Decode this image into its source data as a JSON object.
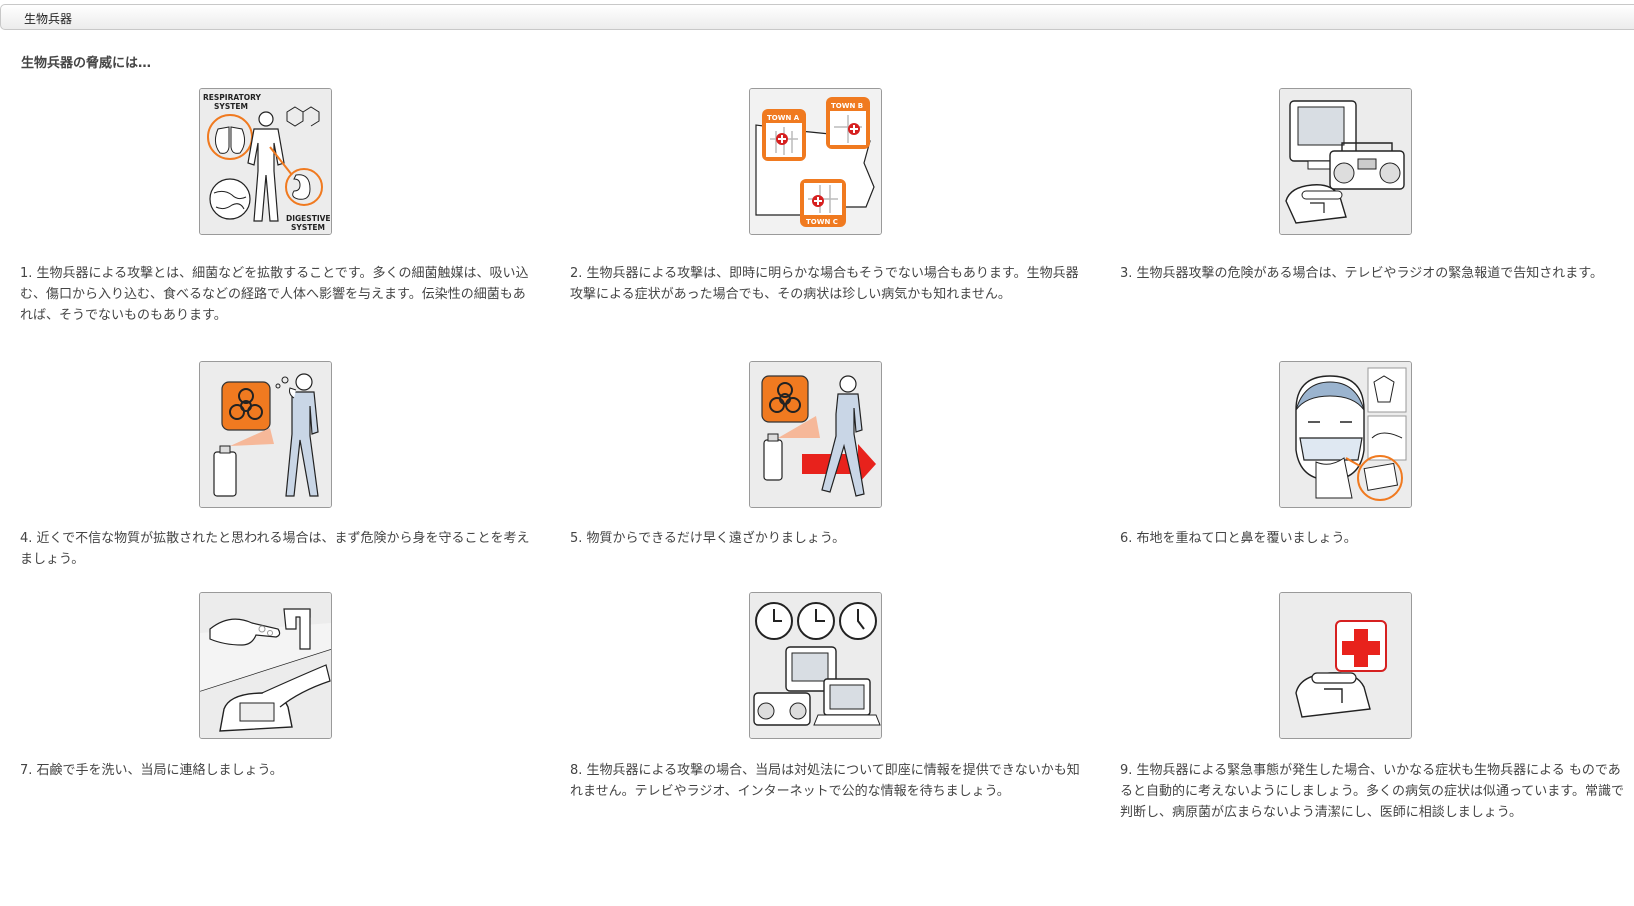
{
  "tab": {
    "title": "生物兵器"
  },
  "heading": "生物兵器の脅威には…",
  "illustrations": {
    "respiratory_label_1": "RESPIRATORY",
    "respiratory_label_2": "SYSTEM",
    "digestive_label_1": "DIGESTIVE",
    "digestive_label_2": "SYSTEM",
    "town_a": "TOWN A",
    "town_b": "TOWN B",
    "town_c": "TOWN C"
  },
  "colors": {
    "accent": "#f07a20",
    "frame_bg": "#e9e9e9",
    "text": "#444444"
  },
  "items": [
    {
      "icon": "body-systems-icon",
      "text": "1. 生物兵器による攻撃とは、細菌などを拡散することです。多くの細菌触媒は、吸い込む、傷口から入り込む、食べるなどの経路で人体へ影響を与えます。伝染性の細菌もあれば、そうでないものもあります。"
    },
    {
      "icon": "town-map-icon",
      "text": "2. 生物兵器による攻撃は、即時に明らかな場合もそうでない場合もあります。生物兵器攻撃による症状があった場合でも、その病状は珍しい病気かも知れません。"
    },
    {
      "icon": "media-devices-icon",
      "text": "3. 生物兵器攻撃の危険がある場合は、テレビやラジオの緊急報道で告知されます。"
    },
    {
      "icon": "biohazard-spray-icon",
      "text": "4. 近くで不信な物質が拡散されたと思われる場合は、まず危険から身を守ることを考えましょう。"
    },
    {
      "icon": "walk-away-icon",
      "text": "5. 物質からできるだけ早く遠ざかりましょう。"
    },
    {
      "icon": "face-mask-icon",
      "text": "6. 布地を重ねて口と鼻を覆いましょう。"
    },
    {
      "icon": "wash-hands-icon",
      "text": "7. 石鹸で手を洗い、当局に連絡しましょう。"
    },
    {
      "icon": "clocks-media-icon",
      "text": "8. 生物兵器による攻撃の場合、当局は対処法について即座に情報を提供できないかも知れません。テレビやラジオ、インターネットで公的な情報を待ちましょう。"
    },
    {
      "icon": "medical-phone-icon",
      "text": "9. 生物兵器による緊急事態が発生した場合、いかなる症状も生物兵器による ものであると自動的に考えないようにしましょう。多くの病気の症状は似通っています。常識で判断し、病原菌が広まらないよう清潔にし、医師に相談しましょう。"
    }
  ]
}
